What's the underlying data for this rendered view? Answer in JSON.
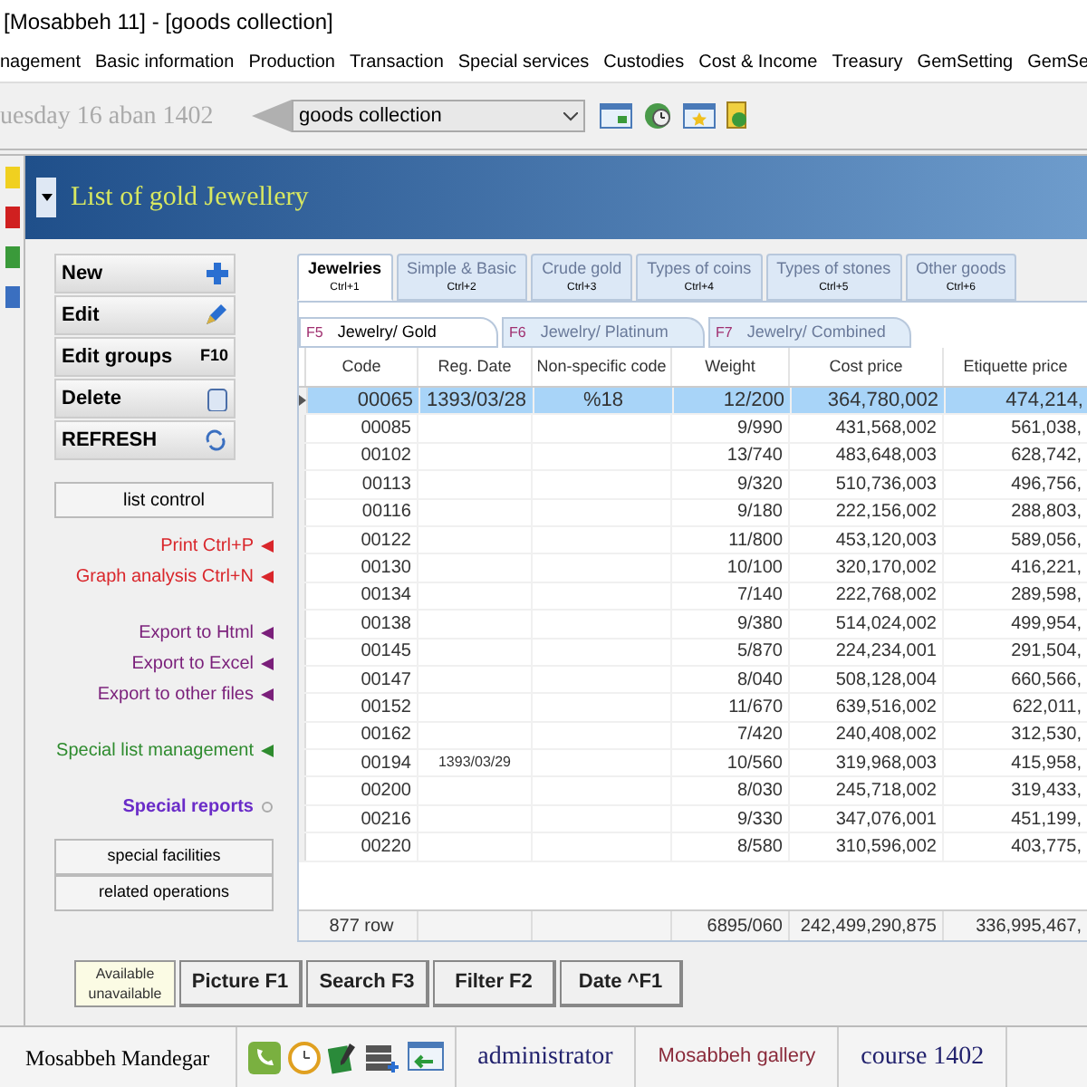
{
  "window": {
    "title": "[Mosabbeh 11] - [goods collection]"
  },
  "menu": [
    "nagement",
    "Basic information",
    "Production",
    "Transaction",
    "Special services",
    "Custodies",
    "Cost & Income",
    "Treasury",
    "GemSetting",
    "GemSe"
  ],
  "toolbar": {
    "date": "uesday 16 aban 1402",
    "combo": "goods collection"
  },
  "header": {
    "title": "List of gold Jewellery"
  },
  "actions": [
    {
      "label": "New",
      "kind": "plus"
    },
    {
      "label": "Edit",
      "kind": "pen"
    },
    {
      "label": "Edit groups",
      "kind": "shortcut",
      "shortcut": "F10"
    },
    {
      "label": "Delete",
      "kind": "bin"
    },
    {
      "label": "REFRESH",
      "kind": "refresh"
    }
  ],
  "list_control": "list control",
  "links": [
    {
      "label": "Print  Ctrl+P",
      "color": "#d9262b",
      "gap": false
    },
    {
      "label": "Graph analysis  Ctrl+N",
      "color": "#d9262b",
      "gap": false
    },
    {
      "label": "Export to Html",
      "color": "#7a1f7a",
      "gap": true
    },
    {
      "label": "Export to Excel",
      "color": "#7a1f7a",
      "gap": false
    },
    {
      "label": "Export to other files",
      "color": "#7a1f7a",
      "gap": false
    },
    {
      "label": "Special list management",
      "color": "#2e8b2e",
      "gap": true
    }
  ],
  "special_reports": "Special reports",
  "side_buttons": [
    "special facilities",
    "related operations"
  ],
  "tabs": [
    {
      "label": "Jewelries",
      "shortcut": "Ctrl+1",
      "selected": true
    },
    {
      "label": "Simple & Basic",
      "shortcut": "Ctrl+2",
      "selected": false
    },
    {
      "label": "Crude gold",
      "shortcut": "Ctrl+3",
      "selected": false
    },
    {
      "label": "Types of coins",
      "shortcut": "Ctrl+4",
      "selected": false
    },
    {
      "label": "Types of stones",
      "shortcut": "Ctrl+5",
      "selected": false
    },
    {
      "label": "Other goods",
      "shortcut": "Ctrl+6",
      "selected": false
    }
  ],
  "subtabs": [
    {
      "key": "F5",
      "label": "Jewelry/ Gold",
      "selected": true
    },
    {
      "key": "F6",
      "label": "Jewelry/ Platinum",
      "selected": false
    },
    {
      "key": "F7",
      "label": "Jewelry/ Combined",
      "selected": false
    }
  ],
  "table": {
    "columns": [
      "Code",
      "Reg. Date",
      "Non-specific code",
      "Weight",
      "Cost price",
      "Etiquette price"
    ],
    "rows": [
      {
        "code": "00065",
        "reg_date": "1393/03/28",
        "non_specific_code": "%18",
        "weight": "12/200",
        "cost_price": "364,780,002",
        "etiquette_price": "474,214,",
        "selected": true
      },
      {
        "code": "00085",
        "weight": "9/990",
        "cost_price": "431,568,002",
        "etiquette_price": "561,038,",
        "selected": false
      },
      {
        "code": "00102",
        "weight": "13/740",
        "cost_price": "483,648,003",
        "etiquette_price": "628,742,",
        "selected": false
      },
      {
        "code": "00113",
        "weight": "9/320",
        "cost_price": "510,736,003",
        "etiquette_price": "496,756,",
        "selected": false
      },
      {
        "code": "00116",
        "weight": "9/180",
        "cost_price": "222,156,002",
        "etiquette_price": "288,803,",
        "selected": false
      },
      {
        "code": "00122",
        "weight": "11/800",
        "cost_price": "453,120,003",
        "etiquette_price": "589,056,",
        "selected": false
      },
      {
        "code": "00130",
        "weight": "10/100",
        "cost_price": "320,170,002",
        "etiquette_price": "416,221,",
        "selected": false
      },
      {
        "code": "00134",
        "weight": "7/140",
        "cost_price": "222,768,002",
        "etiquette_price": "289,598,",
        "selected": false
      },
      {
        "code": "00138",
        "weight": "9/380",
        "cost_price": "514,024,002",
        "etiquette_price": "499,954,",
        "selected": false
      },
      {
        "code": "00145",
        "weight": "5/870",
        "cost_price": "224,234,001",
        "etiquette_price": "291,504,",
        "selected": false
      },
      {
        "code": "00147",
        "weight": "8/040",
        "cost_price": "508,128,004",
        "etiquette_price": "660,566,",
        "selected": false
      },
      {
        "code": "00152",
        "weight": "11/670",
        "cost_price": "639,516,002",
        "etiquette_price": "622,011,",
        "selected": false
      },
      {
        "code": "00162",
        "weight": "7/420",
        "cost_price": "240,408,002",
        "etiquette_price": "312,530,",
        "selected": false
      },
      {
        "code": "00194",
        "reg_date": "1393/03/29",
        "weight": "10/560",
        "cost_price": "319,968,003",
        "etiquette_price": "415,958,",
        "selected": false
      },
      {
        "code": "00200",
        "weight": "8/030",
        "cost_price": "245,718,002",
        "etiquette_price": "319,433,",
        "selected": false
      },
      {
        "code": "00216",
        "weight": "9/330",
        "cost_price": "347,076,001",
        "etiquette_price": "451,199,",
        "selected": false
      },
      {
        "code": "00220",
        "weight": "8/580",
        "cost_price": "310,596,002",
        "etiquette_price": "403,775,",
        "selected": false
      }
    ],
    "footer": {
      "code": "877 row",
      "weight": "6895/060",
      "cost_price": "242,499,290,875",
      "etiquette_price": "336,995,467,"
    }
  },
  "availability": [
    "Available",
    "unavailable"
  ],
  "bottom_buttons": [
    "Picture F1",
    "Search F3",
    "Filter F2",
    "Date ^F1"
  ],
  "status_bar": {
    "user_name": "Mosabbeh Mandegar",
    "role": "administrator",
    "company": "Mosabbeh gallery",
    "course": "course 1402"
  }
}
